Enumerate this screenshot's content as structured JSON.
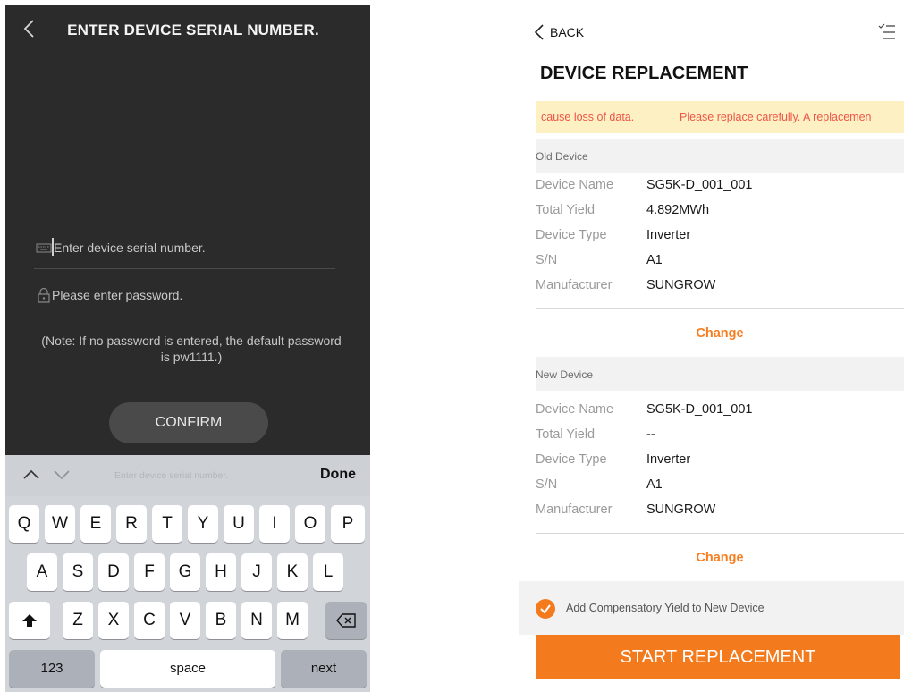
{
  "left": {
    "title": "ENTER DEVICE SERIAL NUMBER.",
    "serial_placeholder": "Enter device serial number.",
    "password_placeholder": "Please enter password.",
    "note": "(Note: If no password is entered, the default password is pw1111.)",
    "confirm_label": "CONFIRM",
    "toolbar": {
      "hint": "Enter device serial number.",
      "done_label": "Done"
    },
    "keyboard": {
      "row1": [
        "Q",
        "W",
        "E",
        "R",
        "T",
        "Y",
        "U",
        "I",
        "O",
        "P"
      ],
      "row2": [
        "A",
        "S",
        "D",
        "F",
        "G",
        "H",
        "J",
        "K",
        "L"
      ],
      "row3": [
        "Z",
        "X",
        "C",
        "V",
        "B",
        "N",
        "M"
      ],
      "numbers_label": "123",
      "space_label": "space",
      "next_label": "next"
    },
    "icons": {
      "back": "chevron-left-icon",
      "serial": "keyboard-icon",
      "password": "lock-icon",
      "shift": "shift-icon",
      "backspace": "backspace-icon"
    }
  },
  "right": {
    "back_label": "BACK",
    "title": "DEVICE REPLACEMENT",
    "warning": {
      "part1": "cause loss of data.",
      "part2": "Please replace carefully. A replacemen"
    },
    "old_device": {
      "header": "Old Device",
      "rows": [
        {
          "key": "Device Name",
          "value": "SG5K-D_001_001"
        },
        {
          "key": "Total Yield",
          "value": "4.892MWh"
        },
        {
          "key": "Device Type",
          "value": "Inverter"
        },
        {
          "key": "S/N",
          "value": "A1"
        },
        {
          "key": "Manufacturer",
          "value": "SUNGROW"
        }
      ],
      "change_label": "Change"
    },
    "new_device": {
      "header": "New Device",
      "rows": [
        {
          "key": "Device Name",
          "value": "SG5K-D_001_001"
        },
        {
          "key": "Total Yield",
          "value": "--"
        },
        {
          "key": "Device Type",
          "value": "Inverter"
        },
        {
          "key": "S/N",
          "value": "A1"
        },
        {
          "key": "Manufacturer",
          "value": "SUNGROW"
        }
      ],
      "change_label": "Change"
    },
    "compensatory_label": "Add Compensatory Yield to New Device",
    "compensatory_checked": true,
    "start_label": "START REPLACEMENT",
    "colors": {
      "accent": "#f37b1d",
      "warning_text": "#f0554a",
      "warning_bg": "#fdf0c2"
    },
    "icons": {
      "back": "chevron-left-icon",
      "menu": "list-menu-icon",
      "check": "checkmark-icon"
    }
  }
}
